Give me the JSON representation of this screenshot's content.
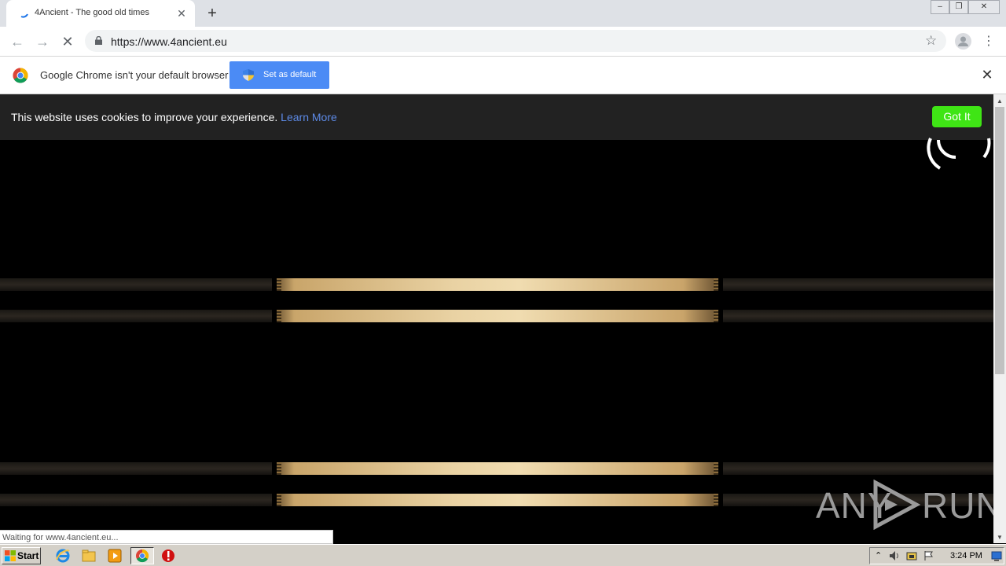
{
  "browser": {
    "tab_title": "4Ancient - The good old times",
    "new_tab_label": "+",
    "url": "https://www.4ancient.eu",
    "status_text": "Waiting for www.4ancient.eu..."
  },
  "infobar": {
    "message": "Google Chrome isn't your default browser",
    "button_label": "Set as default"
  },
  "cookie_banner": {
    "text": "This website uses cookies to improve your experience.",
    "link_text": "Learn More",
    "button_label": "Got It"
  },
  "watermark": {
    "left_text": "ANY",
    "right_text": "RUN"
  },
  "taskbar": {
    "start_label": "Start",
    "clock": "3:24 PM"
  },
  "colors": {
    "cookie_link": "#5d8ae6",
    "got_it": "#3fe515",
    "set_default": "#4b8bf5"
  }
}
